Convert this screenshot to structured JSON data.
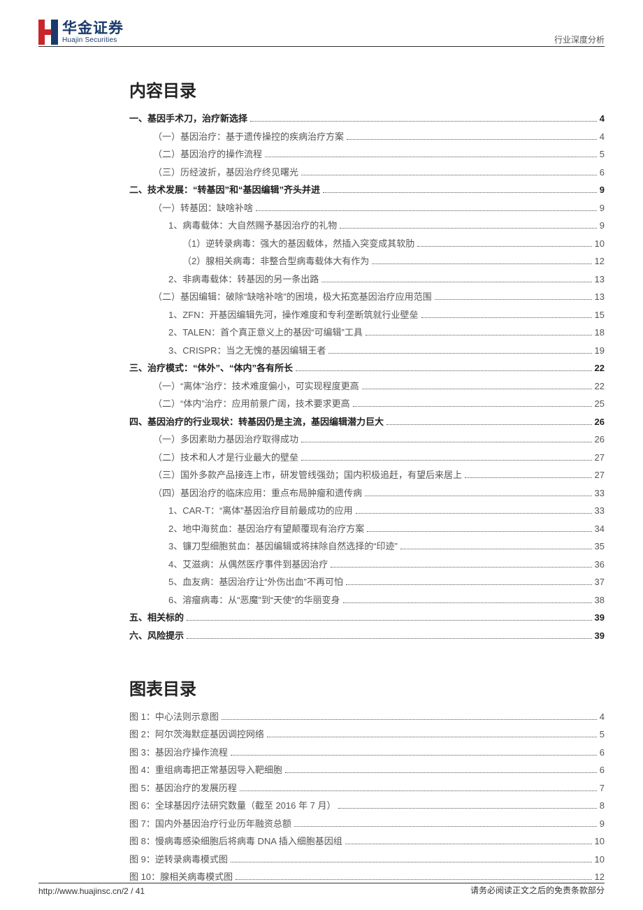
{
  "header": {
    "logo_cn": "华金证券",
    "logo_en": "Huajin Securities",
    "right_text": "行业深度分析"
  },
  "titles": {
    "toc": "内容目录",
    "figs": "图表目录"
  },
  "toc": [
    {
      "level": 0,
      "text": "一、基因手术刀，治疗新选择",
      "page": "4"
    },
    {
      "level": 1,
      "text": "（一）基因治疗：基于遗传操控的疾病治疗方案",
      "page": "4"
    },
    {
      "level": 1,
      "text": "（二）基因治疗的操作流程",
      "page": "5"
    },
    {
      "level": 1,
      "text": "（三）历经波折，基因治疗终见曙光",
      "page": "6"
    },
    {
      "level": 0,
      "text": "二、技术发展：“转基因”和“基因编辑”齐头并进",
      "page": "9"
    },
    {
      "level": 1,
      "text": "（一）转基因：缺啥补啥",
      "page": "9"
    },
    {
      "level": 2,
      "text": "1、病毒载体：大自然赐予基因治疗的礼物",
      "page": "9"
    },
    {
      "level": 3,
      "text": "（1）逆转录病毒：强大的基因载体，然插入突变成其软肋",
      "page": "10"
    },
    {
      "level": 3,
      "text": "（2）腺相关病毒：非整合型病毒载体大有作为",
      "page": "12"
    },
    {
      "level": 2,
      "text": "2、非病毒载体：转基因的另一条出路",
      "page": "13"
    },
    {
      "level": 1,
      "text": "（二）基因编辑：破除“缺啥补啥”的困境，极大拓宽基因治疗应用范围",
      "page": "13"
    },
    {
      "level": 2,
      "text": "1、ZFN：开基因编辑先河，操作难度和专利垄断筑就行业壁垒",
      "page": "15"
    },
    {
      "level": 2,
      "text": "2、TALEN：首个真正意义上的基因“可编辑”工具",
      "page": "18"
    },
    {
      "level": 2,
      "text": "3、CRISPR：当之无愧的基因编辑王者",
      "page": "19"
    },
    {
      "level": 0,
      "text": "三、治疗模式：“体外”、“体内”各有所长",
      "page": "22"
    },
    {
      "level": 1,
      "text": "（一）“离体”治疗：技术难度偏小，可实现程度更高",
      "page": "22"
    },
    {
      "level": 1,
      "text": "（二）“体内”治疗：应用前景广阔，技术要求更高",
      "page": "25"
    },
    {
      "level": 0,
      "text": "四、基因治疗的行业现状：转基因仍是主流，基因编辑潜力巨大",
      "page": "26"
    },
    {
      "level": 1,
      "text": "（一）多因素助力基因治疗取得成功",
      "page": "26"
    },
    {
      "level": 1,
      "text": "（二）技术和人才是行业最大的壁垒",
      "page": "27"
    },
    {
      "level": 1,
      "text": "（三）国外多款产品接连上市，研发管线强劲；国内积极追赶，有望后来居上",
      "page": "27"
    },
    {
      "level": 1,
      "text": "（四）基因治疗的临床应用：重点布局肿瘤和遗传病",
      "page": "33"
    },
    {
      "level": 2,
      "text": "1、CAR-T：“离体”基因治疗目前最成功的应用",
      "page": "33"
    },
    {
      "level": 2,
      "text": "2、地中海贫血：基因治疗有望颠覆现有治疗方案",
      "page": "34"
    },
    {
      "level": 2,
      "text": "3、镰刀型细胞贫血：基因编辑或将抹除自然选择的“印迹”",
      "page": "35"
    },
    {
      "level": 2,
      "text": "4、艾滋病：从偶然医疗事件到基因治疗",
      "page": "36"
    },
    {
      "level": 2,
      "text": "5、血友病：基因治疗让“外伤出血”不再可怕",
      "page": "37"
    },
    {
      "level": 2,
      "text": "6、溶瘤病毒：从“恶魔”到“天使”的华丽变身",
      "page": "38"
    },
    {
      "level": 0,
      "text": "五、相关标的",
      "page": "39"
    },
    {
      "level": 0,
      "text": "六、风险提示",
      "page": "39"
    }
  ],
  "figs": [
    {
      "text": "图 1：中心法则示意图",
      "page": "4"
    },
    {
      "text": "图 2：阿尔茨海默症基因调控网络",
      "page": "5"
    },
    {
      "text": "图 3：基因治疗操作流程",
      "page": "6"
    },
    {
      "text": "图 4：重组病毒把正常基因导入靶细胞",
      "page": "6"
    },
    {
      "text": "图 5：基因治疗的发展历程",
      "page": "7"
    },
    {
      "text": "图 6：全球基因疗法研究数量（截至 2016 年 7 月）",
      "page": "8"
    },
    {
      "text": "图 7：国内外基因治疗行业历年融资总额",
      "page": "9"
    },
    {
      "text": "图 8：慢病毒感染细胞后将病毒 DNA 插入细胞基因组",
      "page": "10"
    },
    {
      "text": "图 9：逆转录病毒模式图",
      "page": "10"
    },
    {
      "text": "图 10：腺相关病毒模式图",
      "page": "12"
    }
  ],
  "footer": {
    "left": "http://www.huajinsc.cn/2 / 41",
    "right": "请务必阅读正文之后的免责条款部分"
  }
}
